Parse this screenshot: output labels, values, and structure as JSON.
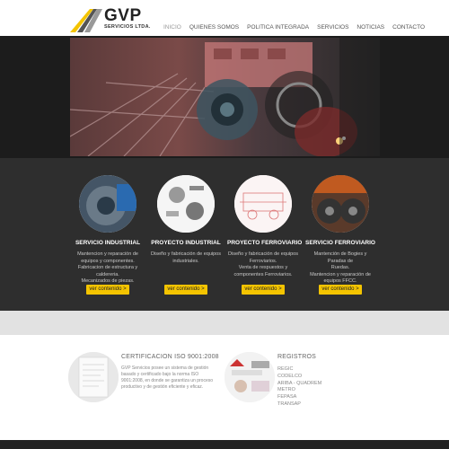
{
  "brand": {
    "name": "GVP",
    "subtitle": "SERVICIOS LTDA."
  },
  "nav": {
    "items": [
      "INICIO",
      "QUIENES SOMOS",
      "POLITICA INTEGRADA",
      "SERVICIOS",
      "NOTICIAS",
      "CONTACTO"
    ]
  },
  "services": [
    {
      "title": "SERVICIO INDUSTRIAL",
      "desc": [
        "Mantencion y reparación de",
        "equipos y componentes.",
        "Fabricacion de estructura y",
        "caldereria.",
        "Mecanizados de piezas."
      ],
      "button": "ver contenido >"
    },
    {
      "title": "PROYECTO INDUSTRIAL",
      "desc": [
        "Diseño y fabricación de equipos",
        "industriales."
      ],
      "button": "ver contenido >"
    },
    {
      "title": "PROYECTO FERROVIARIO",
      "desc": [
        "Diseño y fabricación de equipos",
        "Ferroviarios.",
        "Venta de respuestos y",
        "componentes Ferroviarios."
      ],
      "button": "ver contenido >"
    },
    {
      "title": "SERVICIO FERROVIARIO",
      "desc": [
        "Mantención de Bogies y Paradas de",
        "Ruedas.",
        "Mantencion y reparación de",
        "equipos FFCC."
      ],
      "button": "ver contenido >"
    }
  ],
  "certification": {
    "title": "CERTIFICACION ISO 9001:2008",
    "text": [
      "GVP Servicios posee un sistema de gestión",
      "basado y certificado bajo la norma ISO",
      "9001:2008, en donde se garantiza un proceso",
      "productivo y de gestión eficiente y eficaz."
    ]
  },
  "registros": {
    "title": "REGISTROS",
    "items": [
      "REGIC",
      "CODELCO",
      "ARIBA - QUADREM",
      "METRO",
      "FEPASA",
      "TRANSAP"
    ]
  },
  "colors": {
    "accent": "#f4c400",
    "dark": "#2e2e2e",
    "hero": "#3a2424"
  }
}
